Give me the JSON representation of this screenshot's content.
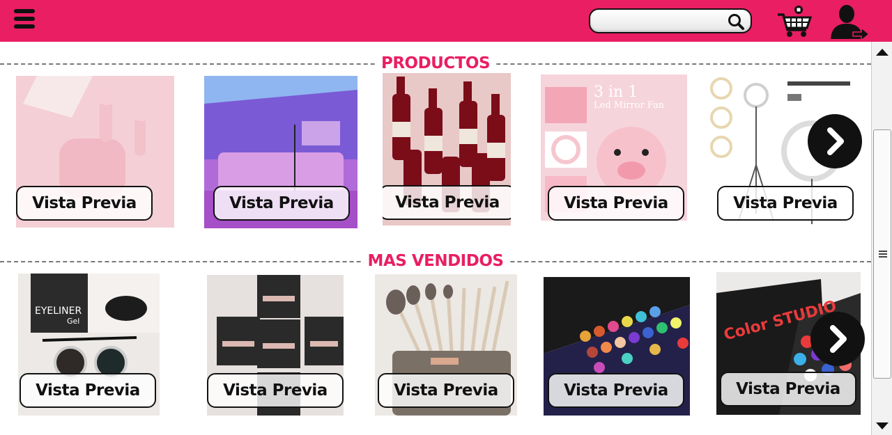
{
  "header": {
    "menu_icon": "hamburger-menu-icon",
    "search": {
      "placeholder": "",
      "value": "",
      "icon": "search-icon"
    },
    "cart_icon": "shopping-cart-icon",
    "user_icon": "user-logout-icon",
    "brand_color": "#e91e63"
  },
  "sections": [
    {
      "title": "PRODUCTOS",
      "products": [
        {
          "image": "pink-earbuds-image",
          "button": "Vista Previa"
        },
        {
          "image": "led-room-lights-image",
          "button": "Vista Previa"
        },
        {
          "image": "wine-bottle-lipsticks-image",
          "button": "Vista Previa"
        },
        {
          "image": "led-mirror-fan-image",
          "button": "Vista Previa",
          "overlay_text": "3 in 1",
          "overlay_sub": "Led Mirror Fan"
        },
        {
          "image": "ring-light-tripod-image",
          "button": "Vista Previa"
        }
      ],
      "next_icon": "chevron-right-icon"
    },
    {
      "title": "MAS VENDIDOS",
      "products": [
        {
          "image": "eyeliner-gel-image",
          "button": "Vista Previa",
          "overlay_text": "EYELINER",
          "overlay_sub": "Gel"
        },
        {
          "image": "false-eyelashes-image",
          "button": "Vista Previa"
        },
        {
          "image": "makeup-brushes-image",
          "button": "Vista Previa"
        },
        {
          "image": "eyeshadow-palette-image",
          "button": "Vista Previa"
        },
        {
          "image": "color-studio-palette-image",
          "button": "Vista Previa",
          "overlay_text": "Color STUDIO"
        }
      ],
      "next_icon": "chevron-right-icon"
    }
  ],
  "scrollbar": {
    "up_icon": "scroll-up-icon",
    "down_icon": "scroll-down-icon"
  }
}
